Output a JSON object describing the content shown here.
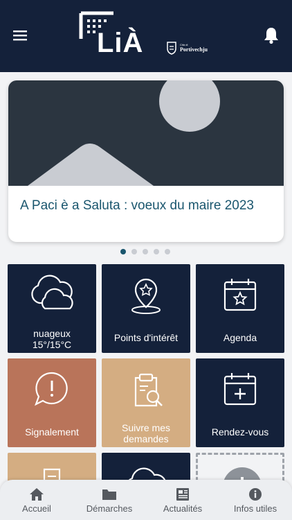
{
  "header": {
    "logo_text": "LiÀ",
    "city_small": "Cità di",
    "city_name": "Portivechju",
    "menu_icon": "hamburger-icon",
    "bell_icon": "bell-icon"
  },
  "news": {
    "title": "A Paci è a Saluta : voeux du maire 2023",
    "image_icon": "image-placeholder-icon",
    "slides_total": 5,
    "slides_active": 1
  },
  "tiles": [
    {
      "label": "nuageux\n15°/15°C",
      "icon": "cloud-icon",
      "color": "navy"
    },
    {
      "label": "Points d'intérêt",
      "icon": "map-pin-star-icon",
      "color": "navy"
    },
    {
      "label": "Agenda",
      "icon": "calendar-star-icon",
      "color": "navy"
    },
    {
      "label": "Signalement",
      "icon": "alert-bubble-icon",
      "color": "terra"
    },
    {
      "label": "Suivre mes demandes",
      "icon": "clipboard-search-icon",
      "color": "sand"
    },
    {
      "label": "Rendez-vous",
      "icon": "calendar-plus-icon",
      "color": "navy"
    }
  ],
  "tabbar": {
    "tabs": [
      {
        "label": "Accueil",
        "icon": "home-icon"
      },
      {
        "label": "Démarches",
        "icon": "folder-icon"
      },
      {
        "label": "Actualités",
        "icon": "newspaper-icon"
      },
      {
        "label": "Infos utiles",
        "icon": "info-icon"
      }
    ]
  },
  "colors": {
    "navy": "#14213a",
    "terracotta": "#b9745a",
    "sand": "#d4ad82",
    "accent": "#1a566e"
  }
}
